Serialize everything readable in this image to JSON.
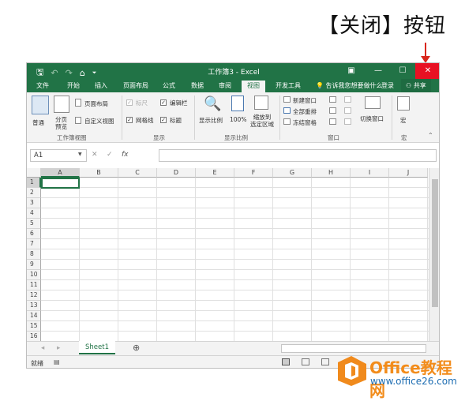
{
  "annotation": {
    "label": "【关闭】按钮",
    "arrow_color": "#d9261c"
  },
  "window": {
    "title": "工作簿3 - Excel",
    "accent": "#217346",
    "close_color": "#e81123",
    "qat": {
      "save": "🖫",
      "undo": "↶",
      "redo": "↷",
      "extra": "⌂",
      "more": "⏷"
    },
    "controls": {
      "ribbon_display": "▣",
      "minimize": "—",
      "maximize": "☐",
      "close": "✕"
    }
  },
  "tabs": [
    "文件",
    "开始",
    "插入",
    "页面布局",
    "公式",
    "数据",
    "审阅",
    "视图",
    "开发工具"
  ],
  "active_tab": "视图",
  "tellme": "告诉我您想要做什么",
  "login": "登录",
  "share": "共享",
  "ribbon": {
    "views": {
      "normal": "普通",
      "pagebreak": "分页\n预览",
      "pagelayout": "页面布局",
      "custom": "自定义视图",
      "group": "工作簿视图"
    },
    "show": {
      "ruler": "标尺",
      "formula_bar": "编辑栏",
      "gridlines": "网格线",
      "headings": "标题",
      "group": "显示"
    },
    "zoom": {
      "zoom": "显示比例",
      "hundred": "100%",
      "to_selection": "缩放到\n选定区域",
      "group": "显示比例"
    },
    "window": {
      "new": "新建窗口",
      "arrange": "全部重排",
      "freeze": "冻结窗格",
      "switch": "切换窗口",
      "group": "窗口"
    },
    "macros": {
      "macro": "宏",
      "group": "宏"
    }
  },
  "name_box": "A1",
  "formula_icons": [
    "✕",
    "✓",
    "fx"
  ],
  "columns": [
    "A",
    "B",
    "C",
    "D",
    "E",
    "F",
    "G",
    "H",
    "I",
    "J"
  ],
  "rows": [
    "1",
    "2",
    "3",
    "4",
    "5",
    "6",
    "7",
    "8",
    "9",
    "10",
    "11",
    "12",
    "13",
    "14",
    "15",
    "16"
  ],
  "sheet_tab": "Sheet1",
  "add_sheet": "⊕",
  "status": {
    "ready": "就绪",
    "macro_icon": "▤"
  },
  "watermark": {
    "title": "Office教程网",
    "url": "www.office26.com"
  }
}
